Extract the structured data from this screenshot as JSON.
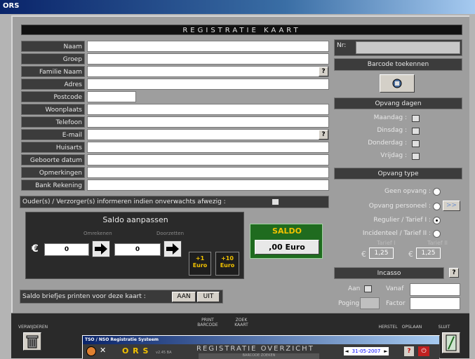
{
  "window": {
    "title": "ORS"
  },
  "header": {
    "title": "REGISTRATIE KAART"
  },
  "fields": {
    "naam": "Naam",
    "groep": "Groep",
    "familie_naam": "Familie Naam",
    "adres": "Adres",
    "postcode": "Postcode",
    "woonplaats": "Woonplaats",
    "telefoon": "Telefoon",
    "email": "E-mail",
    "huisarts": "Huisarts",
    "geboorte_datum": "Geboorte datum",
    "opmerkingen": "Opmerkingen",
    "bank_rekening": "Bank Rekening",
    "help_label": "?"
  },
  "notify": {
    "label": "Ouder(s) / Verzorger(s) informeren indien onverwachts afwezig :"
  },
  "right": {
    "nr_label": "Nr:",
    "barcode_button": "Barcode toekennen",
    "opvang_dagen": "Opvang dagen",
    "days": [
      "Maandag :",
      "Dinsdag :",
      "Donderdag :",
      "Vrijdag :"
    ],
    "opvang_type": "Opvang type",
    "types": [
      "Geen opvang :",
      "Opvang personeel :",
      "Regulier / Tarief I :",
      "Incidenteel / Tarief II :"
    ],
    "more_button": ">>",
    "tarief1_label": "Tarief I",
    "tarief2_label": "Tarief II",
    "tarief1_value": "1,25",
    "tarief2_value": "1,25",
    "euro_sign": "€",
    "incasso": "Incasso",
    "incasso_help": "?",
    "aan_label": "Aan",
    "vanaf_label": "Vanaf",
    "poging_label": "Poging",
    "factor_label": "Factor"
  },
  "saldo": {
    "title": "Saldo aanpassen",
    "omrekenen": "Omrekenen",
    "doorzetten": "Doorzetten",
    "euro_sign": "€",
    "value1": "0",
    "value2": "0",
    "plus1": "+1\nEuro",
    "plus10": "+10\nEuro",
    "saldo_label": "SALDO",
    "saldo_value": ",00 Euro"
  },
  "print": {
    "label": "Saldo briefjes printen voor deze kaart :",
    "aan": "AAN",
    "uit": "UIT"
  },
  "toolbar": {
    "verwijderen": "VERWIJDEREN",
    "print_barcode": "PRINT\nBARCODE",
    "zoek_kaart": "ZOEK\nKAART",
    "herstel": "HERSTEL",
    "opslaan": "OPSLAAN",
    "sluit": "SLUIT"
  },
  "overlay": {
    "title": "TSO / NSO Registratie Systeem",
    "logo": "O R S",
    "version": "v2.45 BA",
    "heading": "REGISTRATIE OVERZICHT",
    "subtitle": "BARCODE ZOEKEN",
    "date": "31-05-2007",
    "help": "?"
  },
  "colors": {
    "accent_green": "#1f6b1f",
    "saldo_yellow": "#f2c200",
    "titlebar": "#0a246a"
  }
}
